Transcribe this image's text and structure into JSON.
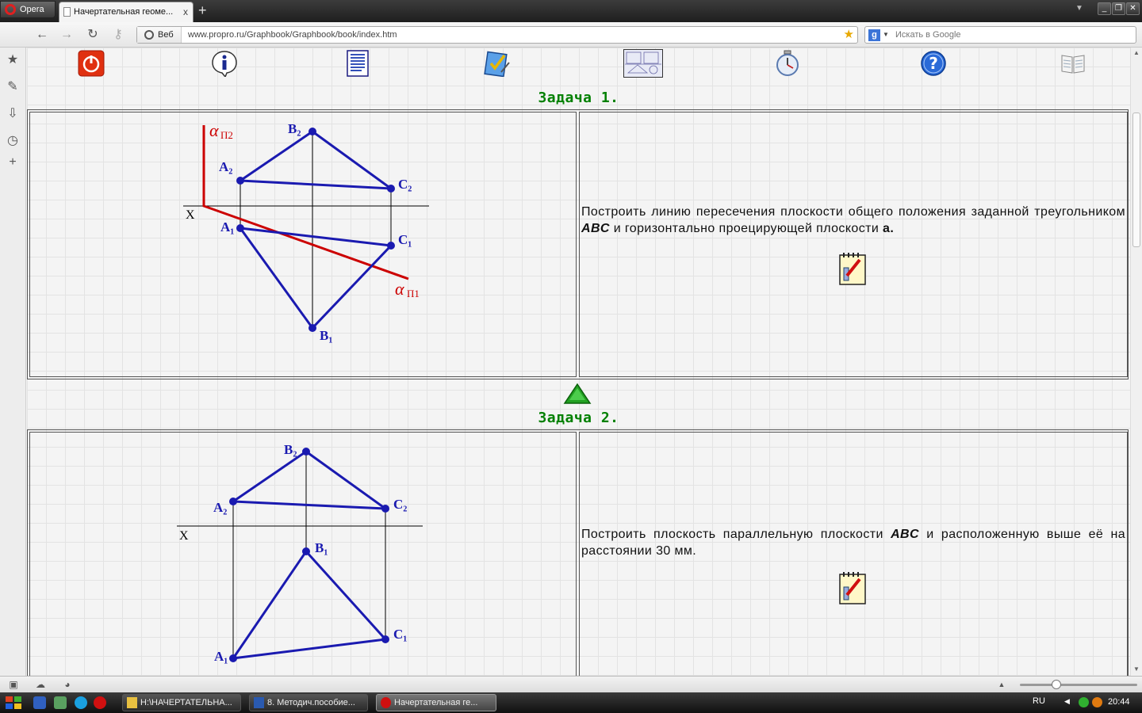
{
  "browser": {
    "menu_label": "Opera",
    "tab_title": "Начертательная геоме...",
    "tab_close": "x",
    "new_tab": "+",
    "address_mode": "Веб",
    "url": "www.propro.ru/Graphbook/Graphbook/book/index.htm",
    "search_placeholder": "Искать в Google",
    "window_buttons": [
      "_",
      "❐",
      "✕"
    ]
  },
  "toolbar_icons": [
    "power-icon",
    "info-icon",
    "document-icon",
    "checklist-icon",
    "drawing-icon",
    "stopwatch-icon",
    "help-icon",
    "book-icon"
  ],
  "tasks": [
    {
      "title": "Задача 1.",
      "text_before": "Построить линию пересечения плоскости общего положения заданной треугольником ",
      "abc": "ABC",
      "text_after": " и горизонтально проецирующей плоскости ",
      "alpha": "a.",
      "labels": {
        "alpha_p2": "α",
        "alpha_p2_sub": "П2",
        "alpha_p1": "α",
        "alpha_p1_sub": "П1",
        "x": "X",
        "a2": "A₂",
        "b2": "B₂",
        "c2": "C₂",
        "a1": "A₁",
        "b1": "B₁",
        "c1": "C₁"
      }
    },
    {
      "title": "Задача 2.",
      "text_before": "Построить плоскость параллельную плоскости ",
      "abc": "ABC",
      "text_after": " и расположенную выше её на расстоянии 30 мм.",
      "labels": {
        "x": "X",
        "a2": "A₂",
        "b2": "B₂",
        "c2": "C₂",
        "a1": "A₁",
        "b1": "B₁",
        "c1": "C₁"
      }
    }
  ],
  "taskbar": {
    "items": [
      "H:\\НАЧЕРТАТЕЛЬНА...",
      "8. Методич.пособие...",
      "Начертательная ге..."
    ],
    "language": "RU",
    "clock": "20:44"
  },
  "colors": {
    "title_green": "#008000",
    "figure_blue": "#1a1ab0",
    "plane_red": "#cc0000"
  }
}
